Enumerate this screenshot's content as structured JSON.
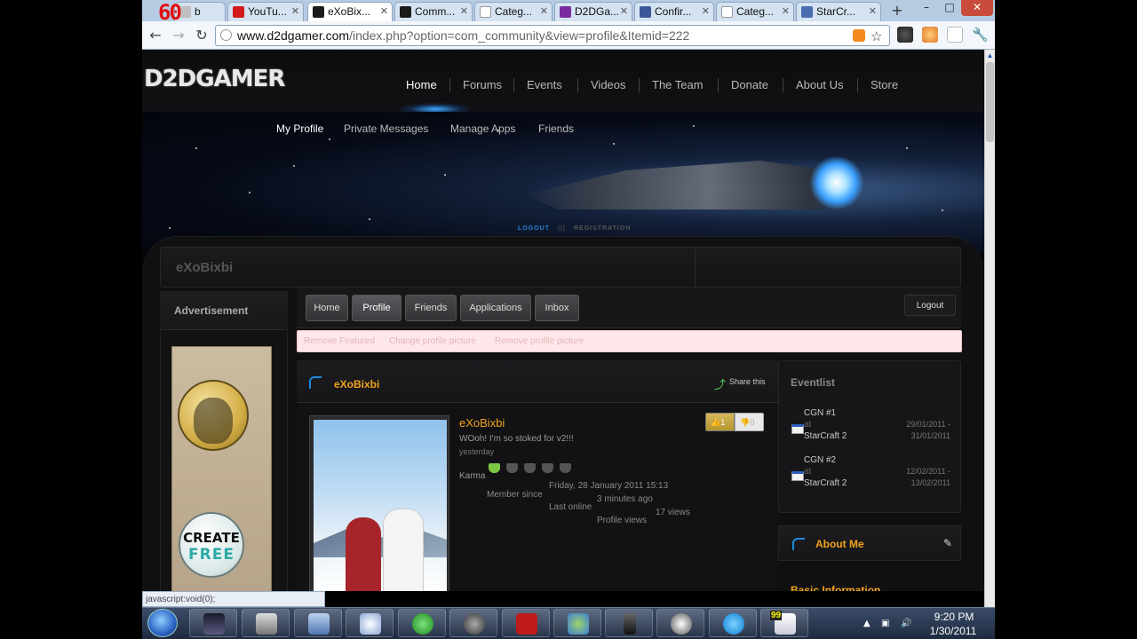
{
  "overlay": {
    "fps": "60"
  },
  "browser": {
    "tabs": [
      {
        "label": "b",
        "icon": "generic-page-icon",
        "color": "#c0c0c0"
      },
      {
        "label": "YouTu...",
        "icon": "youtube-icon",
        "color": "#d11a1a"
      },
      {
        "label": "eXoBix...",
        "icon": "d2dgamer-icon",
        "color": "#1a1a1a"
      },
      {
        "label": "Comm...",
        "icon": "d2dgamer-icon",
        "color": "#1a1a1a"
      },
      {
        "label": "Categ...",
        "icon": "document-icon",
        "color": "#ffffff"
      },
      {
        "label": "D2DGa...",
        "icon": "d2dgamer-x-icon",
        "color": "#7a2c9e"
      },
      {
        "label": "Confir...",
        "icon": "facebook-icon",
        "color": "#3b5998"
      },
      {
        "label": "Categ...",
        "icon": "document-icon",
        "color": "#ffffff"
      },
      {
        "label": "StarCr...",
        "icon": "starcraft-icon",
        "color": "#4a6db0"
      }
    ],
    "active_tab": 2,
    "new_tab": "+",
    "window_controls": {
      "minimize": "–",
      "maximize": "□",
      "close": "✕"
    },
    "back": "←",
    "forward": "→",
    "reload": "↻",
    "url_host": "www.d2dgamer.com",
    "url_path": "/index.php?option=com_community&view=profile&Itemid=222",
    "status_url": "javascript:void(0);"
  },
  "site": {
    "logo": "D2DGAMER",
    "nav": [
      "Home",
      "Forums",
      "Events",
      "Videos",
      "The Team",
      "Donate",
      "About Us",
      "Store"
    ],
    "subnav": [
      "My Profile",
      "Private Messages",
      "Manage Apps",
      "Friends"
    ],
    "auth": {
      "logout": "LOGOUT",
      "sep": "|||",
      "registration": "REGISTRATION"
    },
    "username_bar": "eXoBixbi",
    "advertisement": "Advertisement",
    "ad_button": {
      "line1": "CREATE",
      "line2": "FREE"
    },
    "profile_tabs": [
      "Home",
      "Profile",
      "Friends",
      "Applications",
      "Inbox"
    ],
    "logout_button": "Logout",
    "notice_links": [
      "Remove Featured",
      "Change profile picture",
      "Remove profile picture"
    ],
    "panel_title": "eXoBixbi",
    "share": "Share this",
    "profile": {
      "name": "eXoBixbi",
      "status": "WOoh! I'm so stoked for v2!!!",
      "when": "yesterday",
      "karma_label": "Karma",
      "member_since_label": "Member since",
      "member_since_value": "Friday, 28 January 2011 15:13",
      "last_online_label": "Last online",
      "last_online_value": "3 minutes ago",
      "profile_views_label": "Profile views",
      "profile_views_value": "17 views",
      "likes": "1",
      "dislikes": "0"
    },
    "eventlist": {
      "title": "Eventlist",
      "events": [
        {
          "name": "CGN #1",
          "at": "at",
          "place": "StarCraft 2",
          "date_from": "29/01/2011 -",
          "date_to": "31/01/2011"
        },
        {
          "name": "CGN #2",
          "at": "at",
          "place": "StarCraft 2",
          "date_from": "12/02/2011 -",
          "date_to": "13/02/2011"
        }
      ]
    },
    "about_me": "About Me",
    "basic_info": "Basic Information"
  },
  "taskbar": {
    "apps": [
      "media-player-icon",
      "terminal-icon",
      "mail-icon",
      "explorer-icon",
      "utorrent-icon",
      "steam-icon",
      "filezilla-icon",
      "messenger-icon",
      "mobile-icon",
      "chat-icon",
      "skype-icon",
      "notepad-icon"
    ],
    "clock_time": "9:20 PM",
    "clock_date": "1/30/2011",
    "tray_badge": "99"
  }
}
